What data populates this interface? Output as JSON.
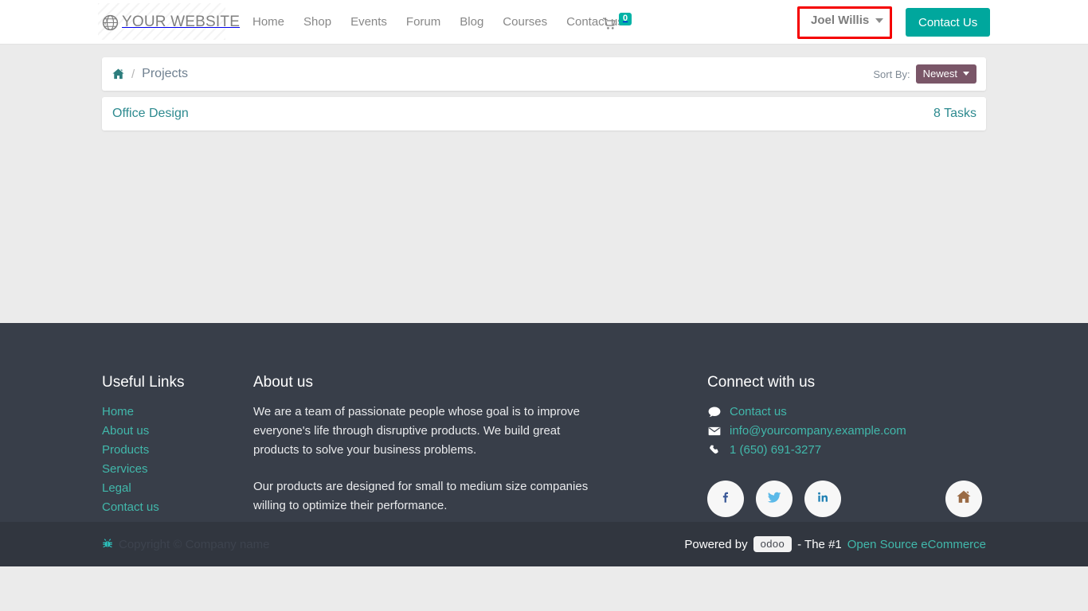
{
  "header": {
    "brand": "YOUR WEBSITE",
    "brand_icon": "globe-icon",
    "nav": [
      {
        "label": "Home"
      },
      {
        "label": "Shop"
      },
      {
        "label": "Events"
      },
      {
        "label": "Forum"
      },
      {
        "label": "Blog"
      },
      {
        "label": "Courses"
      },
      {
        "label": "Contact us"
      }
    ],
    "cart": {
      "icon": "shopping-cart-icon",
      "count": "0",
      "badge_color": "#00b3a6"
    },
    "user_menu": {
      "label": "Joel Willis",
      "caret": "chevron-down-icon"
    },
    "contact_button": {
      "label": "Contact Us",
      "color": "#00a79d"
    },
    "highlight": {
      "color": "#f50000"
    }
  },
  "breadcrumb": {
    "home_icon": "home-icon",
    "separator": "/",
    "current": "Projects"
  },
  "sort": {
    "label": "Sort By:",
    "value": "Newest",
    "options": [
      "Newest"
    ],
    "color": "#7a5668"
  },
  "projects": [
    {
      "name": "Office Design",
      "tasks": "8 Tasks"
    }
  ],
  "footer": {
    "useful_links": {
      "title": "Useful Links",
      "items": [
        {
          "label": "Home"
        },
        {
          "label": "About us"
        },
        {
          "label": "Products"
        },
        {
          "label": "Services"
        },
        {
          "label": "Legal"
        },
        {
          "label": "Contact us"
        }
      ]
    },
    "about": {
      "title": "About us",
      "paragraph1": "We are a team of passionate people whose goal is to improve everyone's life through disruptive products. We build great products to solve your business problems.",
      "paragraph2": "Our products are designed for small to medium size companies willing to optimize their performance."
    },
    "connect": {
      "title": "Connect with us",
      "rows": [
        {
          "icon": "comment-icon",
          "label": "Contact us"
        },
        {
          "icon": "envelope-icon",
          "label": "info@yourcompany.example.com"
        },
        {
          "icon": "phone-icon",
          "label": "1 (650) 691-3277"
        }
      ],
      "socials": [
        {
          "icon": "facebook-icon",
          "color": "#3b5998"
        },
        {
          "icon": "twitter-icon",
          "color": "#5bb9e8"
        },
        {
          "icon": "linkedin-icon",
          "color": "#2181b4"
        },
        {
          "icon": "home-icon",
          "color": "#9a6b45"
        }
      ]
    },
    "bottom": {
      "bug_icon": "bug-icon",
      "copyright": "Copyright © Company name",
      "powered_prefix": "Powered by",
      "odoo_badge": "odoo",
      "powered_middle": "- The #1",
      "powered_link": "Open Source eCommerce"
    }
  },
  "theme": {
    "teal": "#00a79d",
    "link_teal": "#41b8ab",
    "footer_bg": "#383e49",
    "bottom_bg": "#31363f",
    "page_bg": "#ebebeb"
  }
}
